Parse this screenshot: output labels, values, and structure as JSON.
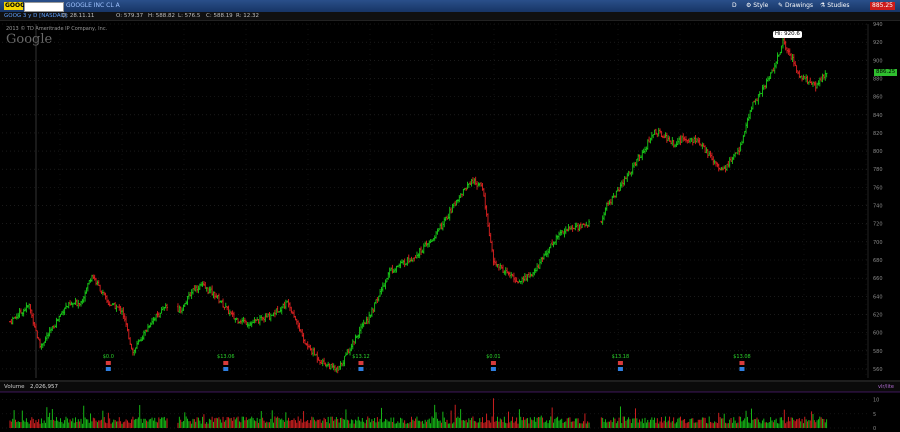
{
  "header": {
    "symbol": "GOOG",
    "symbol_field": "",
    "name": "GOOGLE INC CL A",
    "buttons": {
      "d": "D",
      "style": "Style",
      "drawings": "Drawings",
      "studies": "Studies",
      "price": "885.25"
    }
  },
  "toolbar": {
    "chart_id": "GOOG 3 y D [NASDAQ]",
    "date": "D: 28.11.11",
    "open": "O: 579.37",
    "high": "H: 588.82",
    "low": "L: 576.5",
    "close": "C: 588.19",
    "range": "R: 12.32"
  },
  "overlay": {
    "copyright": "2013 © TD Ameritrade IP Company, Inc.",
    "logo": "Google",
    "hi_label": "Hi: 920.6",
    "last_label": "886.25",
    "volume_label": "Volume",
    "volume_value": "2,026,957",
    "right_note": "vlr/lite"
  },
  "chart_data": {
    "type": "ohlc",
    "colors": {
      "up": "#18c918",
      "down": "#e12222",
      "volume_up": "#18c918",
      "volume_down": "#e12222",
      "event": "#2bd42b"
    },
    "price_axis": {
      "min": 550,
      "max": 940,
      "ticks": [
        560,
        580,
        600,
        620,
        640,
        660,
        680,
        700,
        720,
        740,
        760,
        780,
        800,
        820,
        840,
        860,
        880,
        900,
        920,
        940
      ]
    },
    "volume_axis": {
      "min": 0,
      "max": 12,
      "ticks": [
        0,
        5,
        10
      ]
    },
    "anchors": [
      [
        0,
        612
      ],
      [
        14,
        630
      ],
      [
        22,
        585
      ],
      [
        30,
        602
      ],
      [
        40,
        628
      ],
      [
        52,
        634
      ],
      [
        60,
        664
      ],
      [
        66,
        648
      ],
      [
        72,
        632
      ],
      [
        82,
        625
      ],
      [
        90,
        578
      ],
      [
        104,
        614
      ],
      [
        114,
        628
      ],
      [
        126,
        626
      ],
      [
        134,
        648
      ],
      [
        140,
        652
      ],
      [
        150,
        642
      ],
      [
        164,
        616
      ],
      [
        176,
        610
      ],
      [
        190,
        618
      ],
      [
        204,
        634
      ],
      [
        210,
        612
      ],
      [
        216,
        588
      ],
      [
        228,
        568
      ],
      [
        240,
        558
      ],
      [
        252,
        592
      ],
      [
        264,
        620
      ],
      [
        278,
        668
      ],
      [
        296,
        684
      ],
      [
        308,
        700
      ],
      [
        318,
        722
      ],
      [
        328,
        748
      ],
      [
        338,
        768
      ],
      [
        346,
        760
      ],
      [
        354,
        678
      ],
      [
        362,
        668
      ],
      [
        372,
        656
      ],
      [
        384,
        666
      ],
      [
        394,
        692
      ],
      [
        404,
        712
      ],
      [
        414,
        716
      ],
      [
        424,
        720
      ],
      [
        430,
        702
      ],
      [
        436,
        738
      ],
      [
        446,
        758
      ],
      [
        456,
        782
      ],
      [
        466,
        806
      ],
      [
        472,
        822
      ],
      [
        478,
        818
      ],
      [
        486,
        808
      ],
      [
        494,
        814
      ],
      [
        502,
        812
      ],
      [
        512,
        796
      ],
      [
        522,
        778
      ],
      [
        534,
        802
      ],
      [
        544,
        852
      ],
      [
        552,
        870
      ],
      [
        560,
        894
      ],
      [
        566,
        920
      ],
      [
        572,
        904
      ],
      [
        578,
        884
      ],
      [
        590,
        872
      ],
      [
        598,
        886
      ]
    ],
    "events": [
      {
        "label": "$0.0",
        "index": 72
      },
      {
        "label": "$13.06",
        "index": 158
      },
      {
        "label": "$13.12",
        "index": 257
      },
      {
        "label": "$0.01",
        "index": 354
      },
      {
        "label": "$13.18",
        "index": 447
      },
      {
        "label": "$13.08",
        "index": 536
      }
    ]
  }
}
